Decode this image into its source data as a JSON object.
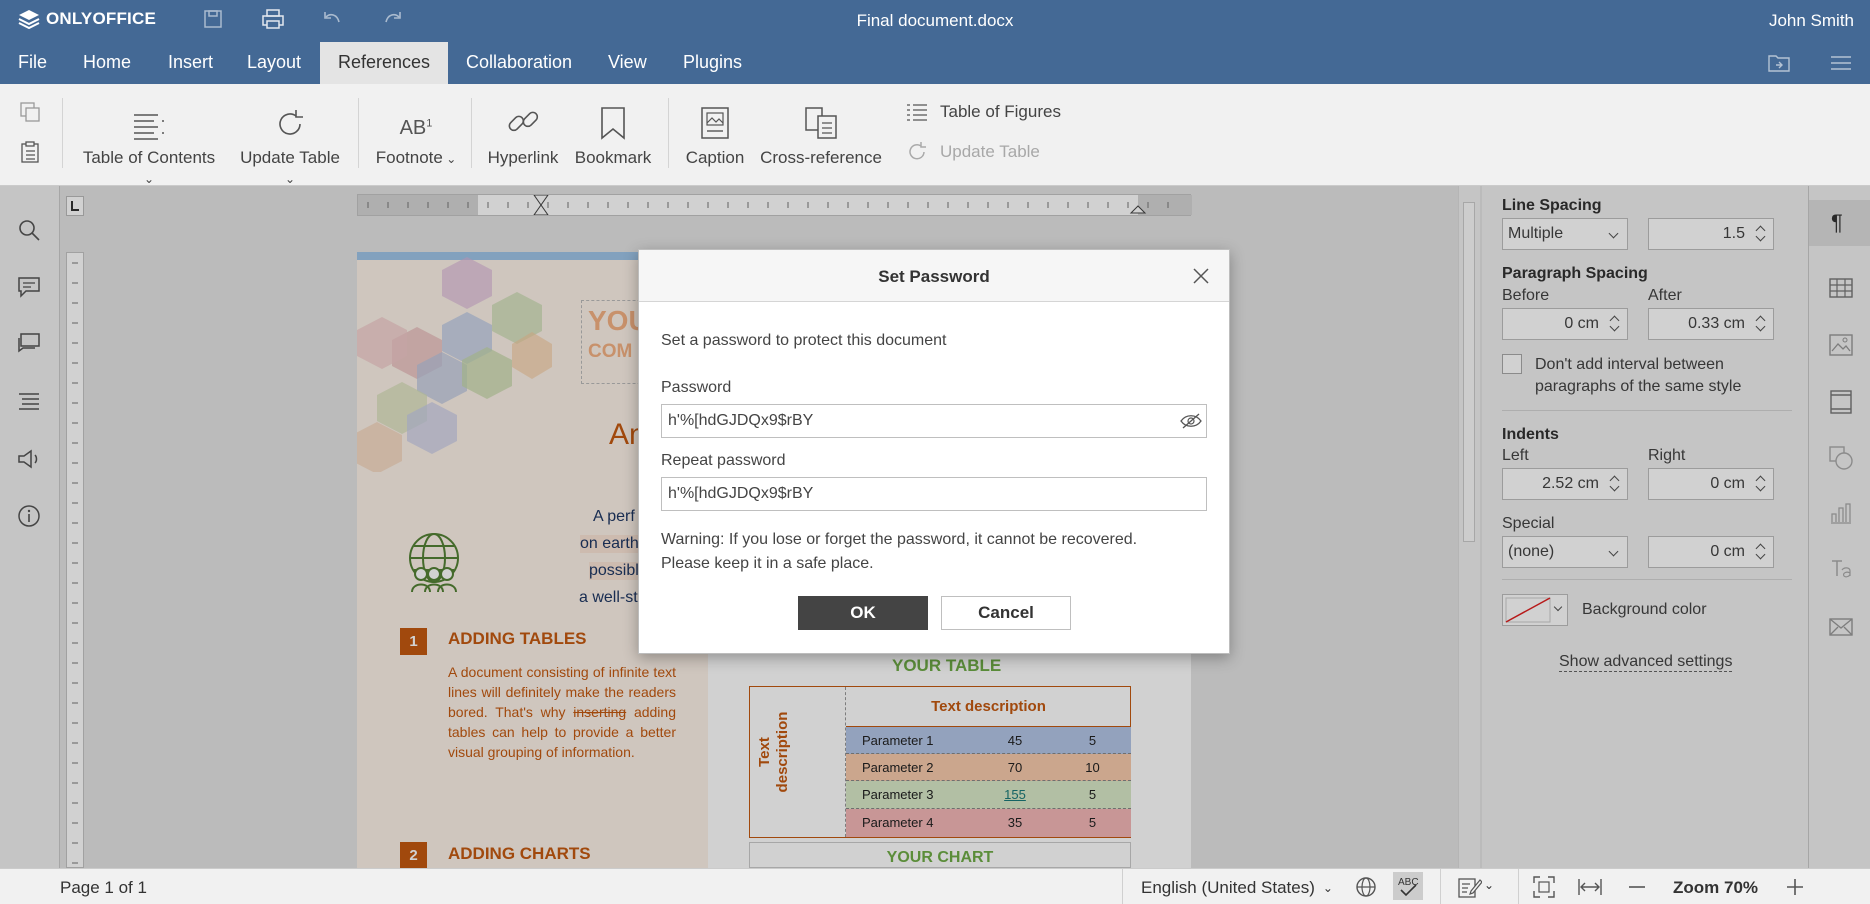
{
  "app": {
    "brand": "ONLYOFFICE",
    "document_title": "Final document.docx",
    "user_name": "John Smith"
  },
  "menu": {
    "tabs": [
      {
        "label": "File"
      },
      {
        "label": "Home"
      },
      {
        "label": "Insert"
      },
      {
        "label": "Layout"
      },
      {
        "label": "References",
        "active": true
      },
      {
        "label": "Collaboration"
      },
      {
        "label": "View"
      },
      {
        "label": "Plugins"
      }
    ]
  },
  "ribbon": {
    "table_of_contents": "Table of Contents",
    "update_table": "Update Table",
    "footnote": "Footnote",
    "hyperlink": "Hyperlink",
    "bookmark": "Bookmark",
    "caption": "Caption",
    "cross_reference": "Cross-reference",
    "table_of_figures": "Table of Figures",
    "update_table_disabled": "Update Table"
  },
  "document": {
    "heading_partial_1": "YOU",
    "heading_partial_2": "COM",
    "title_partial": "An",
    "para_frag_1": "A perf",
    "para_frag_2": "on earth",
    "para_frag_3": "possibl",
    "para_frag_4": "a well-st",
    "section1_num": "1",
    "section1_title": "ADDING TABLES",
    "section1_body": "A document consisting of infinite text lines will definitely make the readers bored. That's why inserting adding tables can help to provide a better visual grouping of information.",
    "section1_strike": "inserting",
    "section2_num": "2",
    "section2_title": "ADDING CHARTS",
    "your_table": "YOUR TABLE",
    "your_chart": "YOUR CHART",
    "table": {
      "header": "Text description",
      "side": "Text description",
      "rows": [
        {
          "name": "Parameter 1",
          "a": "45",
          "b": "5"
        },
        {
          "name": "Parameter 2",
          "a": "70",
          "b": "10"
        },
        {
          "name": "Parameter 3",
          "a": "155",
          "b": "5"
        },
        {
          "name": "Parameter 4",
          "a": "35",
          "b": "5"
        }
      ]
    }
  },
  "settings": {
    "line_spacing_label": "Line Spacing",
    "line_spacing_type": "Multiple",
    "line_spacing_value": "1.5",
    "paragraph_spacing_label": "Paragraph Spacing",
    "before_label": "Before",
    "before_value": "0 cm",
    "after_label": "After",
    "after_value": "0.33 cm",
    "dont_add_interval": "Don't add interval between paragraphs of the same style",
    "indents_label": "Indents",
    "left_label": "Left",
    "left_value": "2.52 cm",
    "right_label": "Right",
    "right_value": "0 cm",
    "special_label": "Special",
    "special_type": "(none)",
    "special_value": "0 cm",
    "background_color_label": "Background color",
    "show_advanced": "Show advanced settings"
  },
  "statusbar": {
    "page_info": "Page 1 of 1",
    "language": "English (United States)",
    "zoom": "Zoom 70%"
  },
  "dialog": {
    "title": "Set Password",
    "description": "Set a password to protect this document",
    "password_label": "Password",
    "password_value": "h'%[hdGJDQx9$rBY",
    "repeat_label": "Repeat password",
    "repeat_value": "h'%[hdGJDQx9$rBY",
    "warning_line1": "Warning: If you lose or forget the password, it cannot be recovered.",
    "warning_line2": "Please keep it in a safe place.",
    "ok_label": "OK",
    "cancel_label": "Cancel"
  },
  "colors": {
    "header": "#446995",
    "accent_orange": "#c55a11",
    "accent_green": "#70ad47",
    "dialog_ok": "#444444"
  }
}
